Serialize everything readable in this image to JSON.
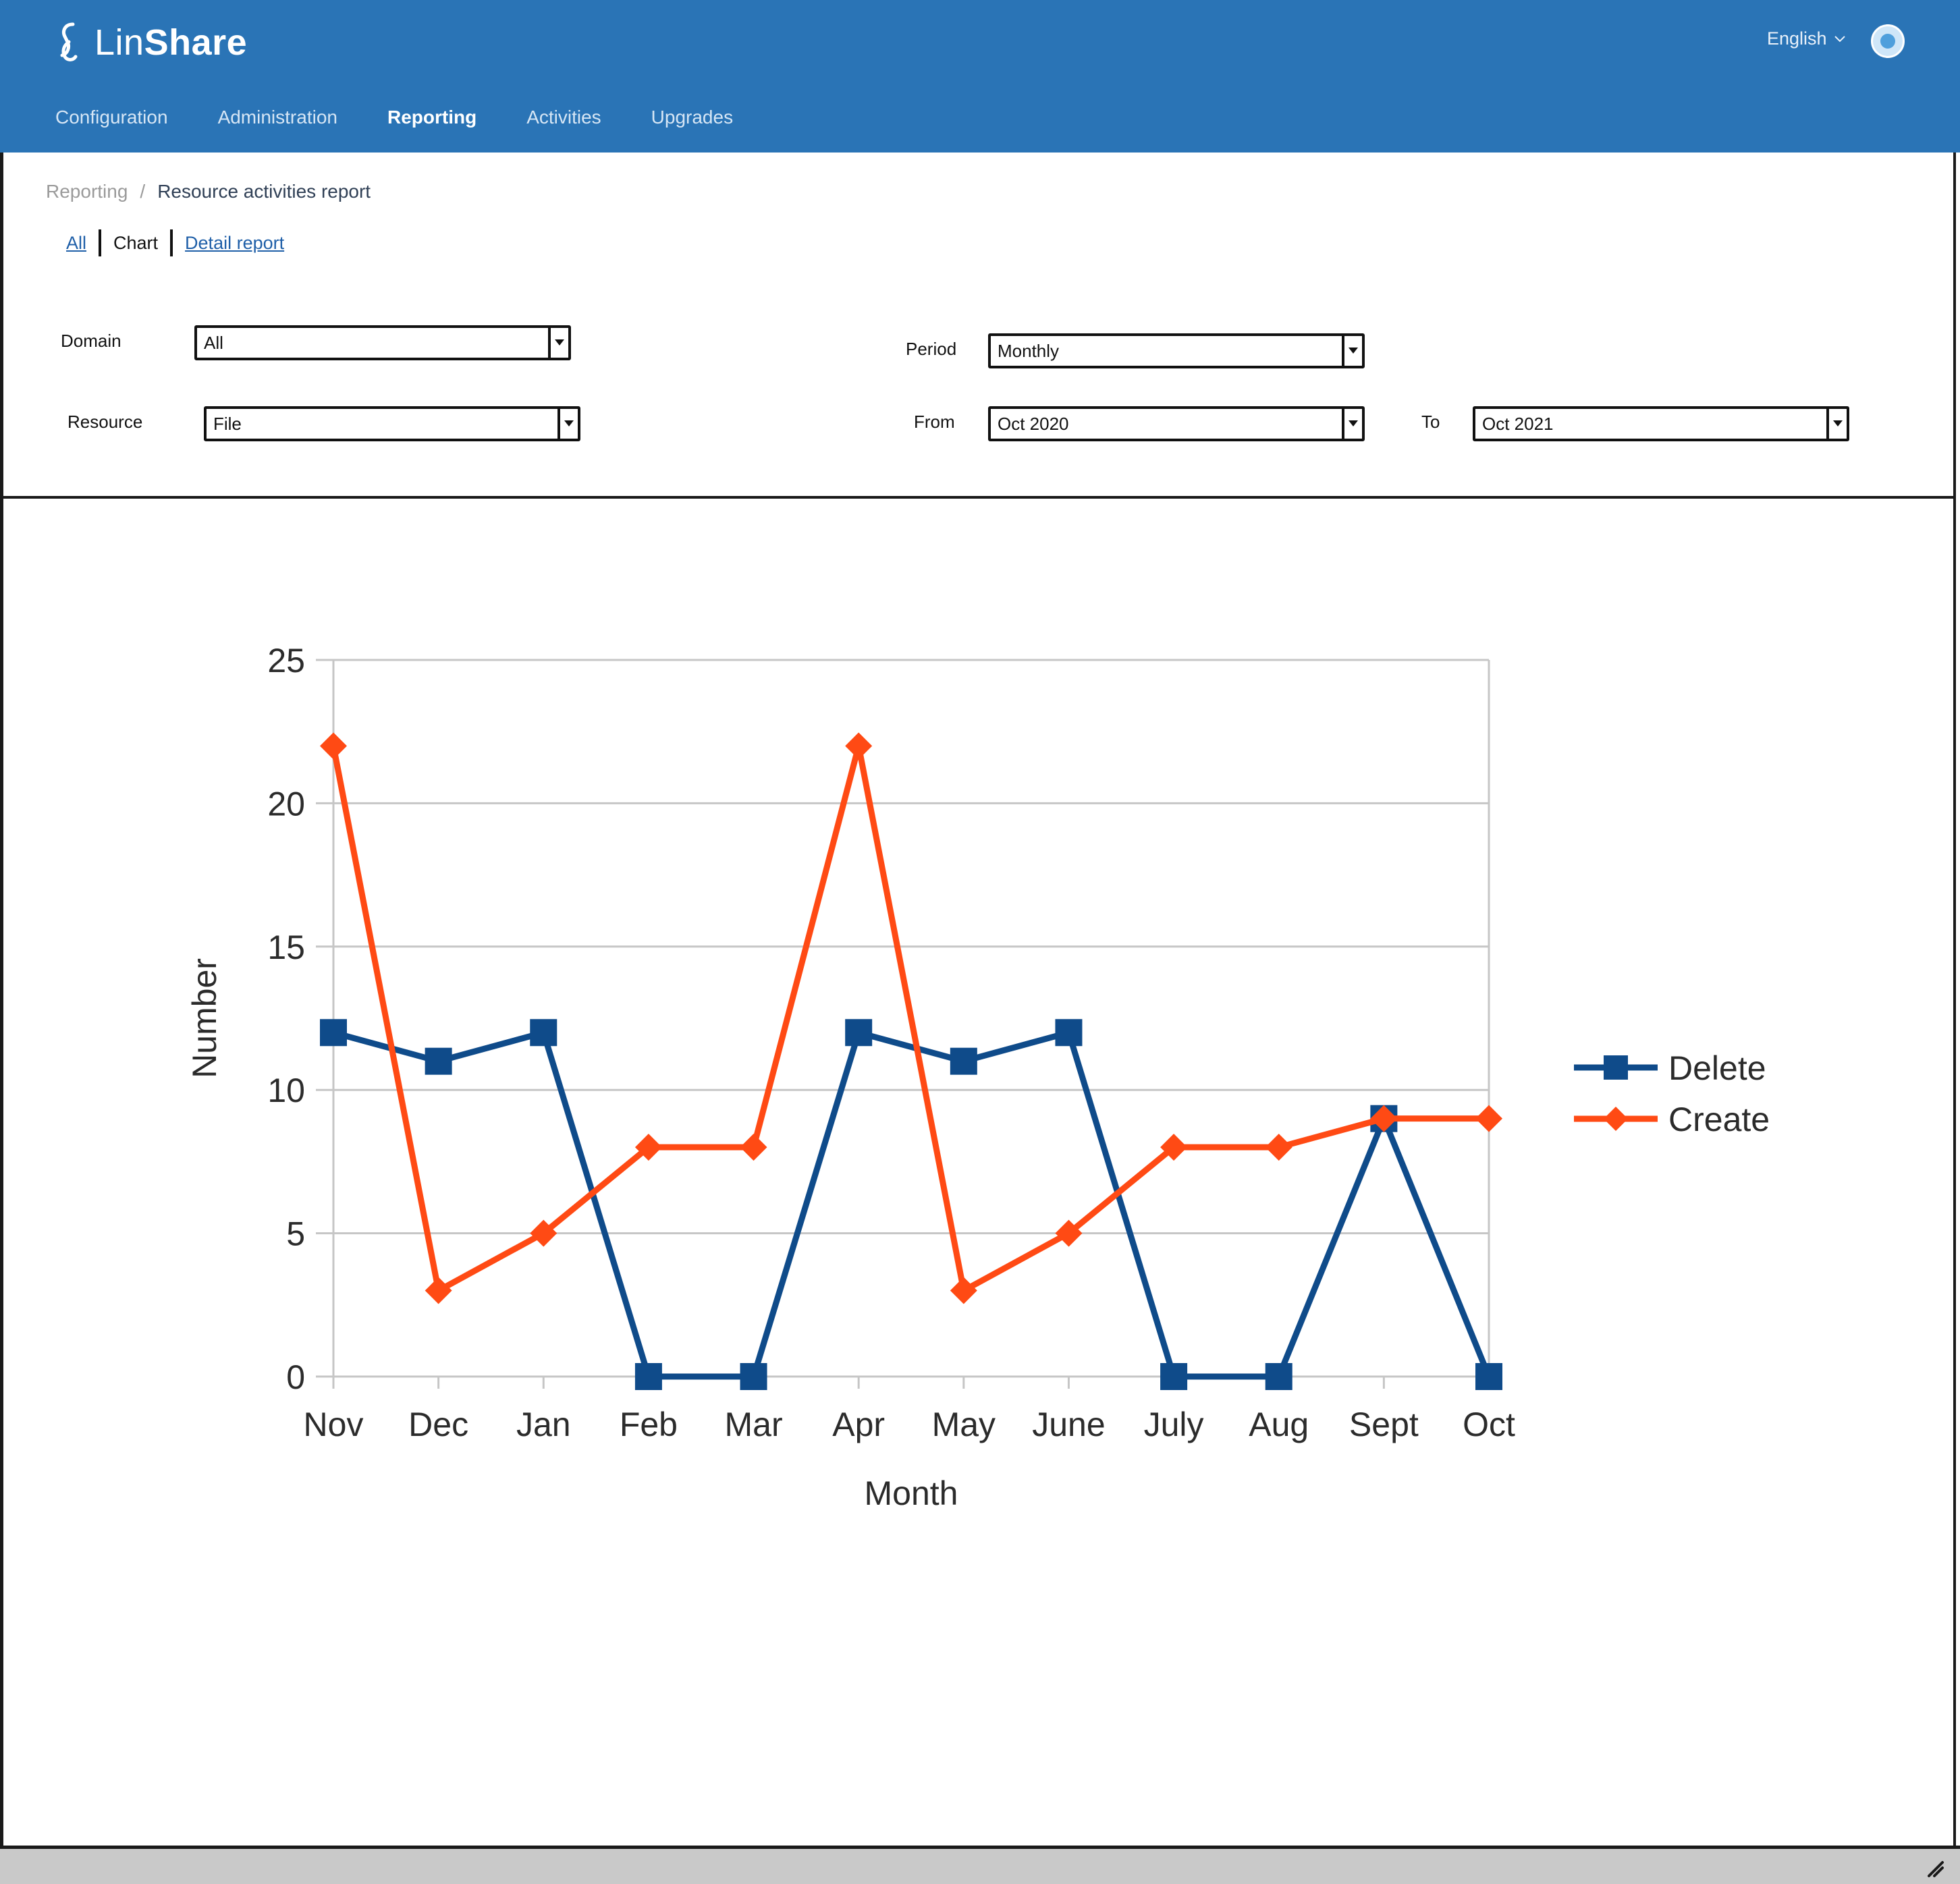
{
  "app": {
    "brand_light": "Lin",
    "brand_bold": "Share",
    "language": "English"
  },
  "nav": {
    "items": [
      "Configuration",
      "Administration",
      "Reporting",
      "Activities",
      "Upgrades"
    ],
    "active": "Reporting"
  },
  "breadcrumb": {
    "parent": "Reporting",
    "separator": "/",
    "current": "Resource activities report"
  },
  "subtabs": {
    "all": "All",
    "chart": "Chart",
    "detail": "Detail report"
  },
  "filters": {
    "domain": {
      "label": "Domain",
      "value": "All"
    },
    "resource": {
      "label": "Resource",
      "value": "File"
    },
    "period": {
      "label": "Period",
      "value": "Monthly"
    },
    "from": {
      "label": "From",
      "value": "Oct 2020"
    },
    "to": {
      "label": "To",
      "value": "Oct 2021"
    }
  },
  "colors": {
    "header": "#2a74b6",
    "delete": "#0f4b8a",
    "create": "#ff4a14",
    "grid": "#c6c6c6"
  },
  "chart_data": {
    "type": "line",
    "categories": [
      "Nov",
      "Dec",
      "Jan",
      "Feb",
      "Mar",
      "Apr",
      "May",
      "June",
      "July",
      "Aug",
      "Sept",
      "Oct"
    ],
    "series": [
      {
        "name": "Delete",
        "marker": "square",
        "values": [
          12,
          11,
          12,
          0,
          0,
          12,
          11,
          12,
          0,
          0,
          9,
          0
        ]
      },
      {
        "name": "Create",
        "marker": "diamond",
        "values": [
          22,
          3,
          5,
          8,
          8,
          22,
          3,
          5,
          8,
          8,
          9,
          9
        ]
      }
    ],
    "xlabel": "Month",
    "ylabel": "Number",
    "ylim": [
      0,
      25
    ],
    "yticks": [
      0,
      5,
      10,
      15,
      20,
      25
    ],
    "grid": true,
    "legend_position": "right"
  }
}
